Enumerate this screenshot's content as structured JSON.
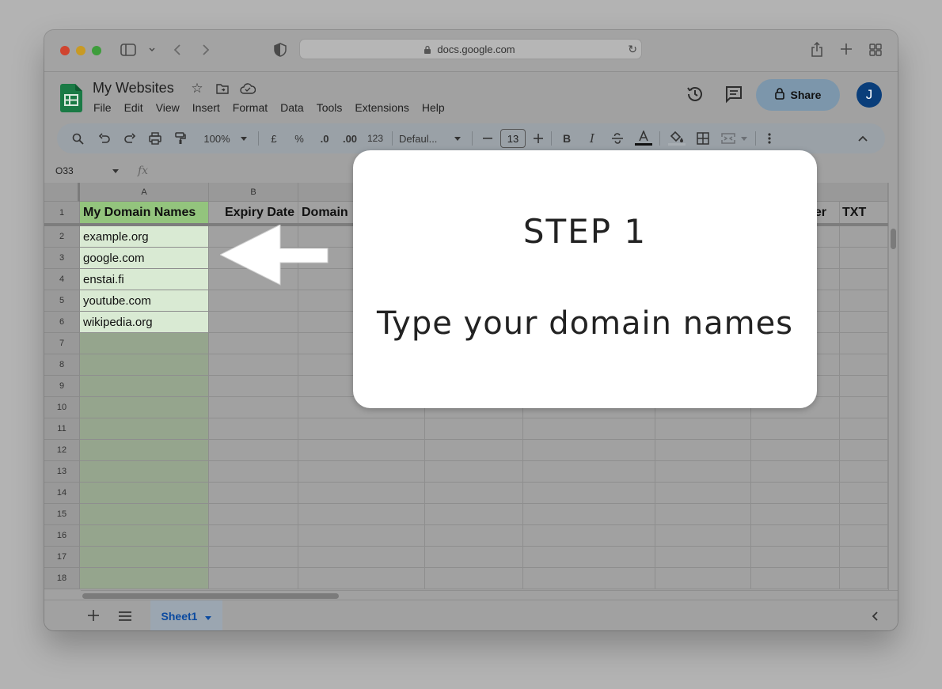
{
  "browser": {
    "url": "docs.google.com"
  },
  "doc": {
    "title": "My Websites",
    "menu": [
      "File",
      "Edit",
      "View",
      "Insert",
      "Format",
      "Data",
      "Tools",
      "Extensions",
      "Help"
    ],
    "share_label": "Share",
    "avatar_initial": "J"
  },
  "toolbar": {
    "zoom": "100%",
    "currency": "£",
    "percent": "%",
    "dec_decrease": ".0",
    "dec_increase": ".00",
    "format_num": "123",
    "font": "Defaul...",
    "font_size": "13"
  },
  "formula_bar": {
    "name_box": "O33",
    "fx": "fx"
  },
  "grid": {
    "columns": [
      "A",
      "B"
    ],
    "rows": [
      "1",
      "2",
      "3",
      "4",
      "5",
      "6",
      "7",
      "8",
      "9",
      "10",
      "11",
      "12",
      "13",
      "14",
      "15",
      "16",
      "17",
      "18"
    ],
    "headers": {
      "a": "My Domain Names",
      "b": "Expiry Date",
      "c": "Domain",
      "g": "er",
      "h": "TXT"
    },
    "domains": [
      "example.org",
      "google.com",
      "enstai.fi",
      "youtube.com",
      "wikipedia.org"
    ]
  },
  "sheet_tab": {
    "name": "Sheet1"
  },
  "overlay": {
    "step": "STEP 1",
    "instruction": "Type your domain names"
  },
  "colors": {
    "highlight_column": "#95a58d",
    "highlight_cells": "#d9ead3",
    "header_green": "#93c47d",
    "share_button": "#7c96ab",
    "avatar": "#0a3e7a"
  }
}
